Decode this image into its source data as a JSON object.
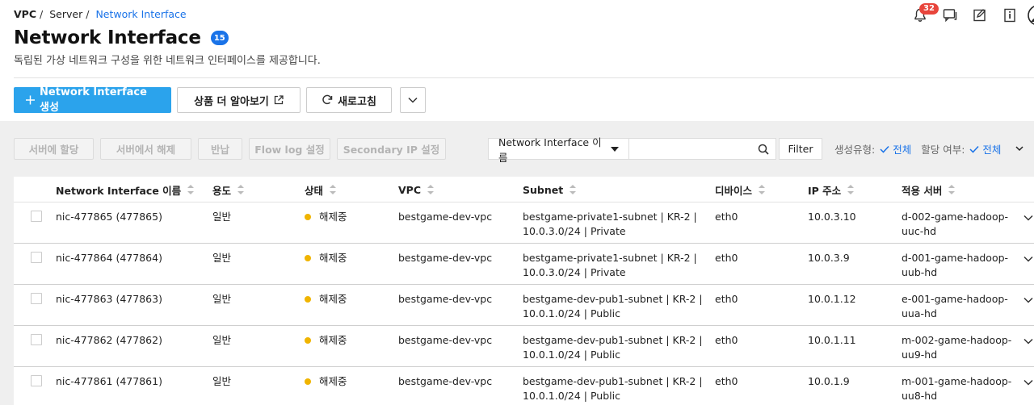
{
  "breadcrumb": {
    "root": "VPC",
    "mid": "Server",
    "current": "Network Interface"
  },
  "header": {
    "notification_count": "32"
  },
  "page": {
    "title": "Network Interface",
    "count": "15",
    "subtitle": "독립된 가상 네트워크 구성을 위한 네트워크 인터페이스를 제공합니다."
  },
  "actions": {
    "create": "Network Interface 생성",
    "learn_more": "상품 더 알아보기",
    "refresh": "새로고침"
  },
  "toolbar": {
    "assign_server": "서버에 할당",
    "release_server": "서버에서 해제",
    "return": "반납",
    "flowlog": "Flow log 설정",
    "secondary_ip": "Secondary IP 설정"
  },
  "search": {
    "field": "Network Interface 이름",
    "value": ""
  },
  "filter": {
    "label": "Filter",
    "type_label": "생성유형:",
    "type_value": "전체",
    "assign_label": "할당 여부:",
    "assign_value": "전체"
  },
  "columns": [
    "Network Interface 이름",
    "용도",
    "상태",
    "VPC",
    "Subnet",
    "디바이스",
    "IP 주소",
    "적용 서버"
  ],
  "rows": [
    {
      "name": "nic-477865 (477865)",
      "usage": "일반",
      "status": "해제중",
      "vpc": "bestgame-dev-vpc",
      "subnet1": "bestgame-private1-subnet | KR-2 |",
      "subnet2": "10.0.3.0/24 | Private",
      "device": "eth0",
      "ip": "10.0.3.10",
      "server1": "d-002-game-hadoop-",
      "server2": "uuc-hd"
    },
    {
      "name": "nic-477864 (477864)",
      "usage": "일반",
      "status": "해제중",
      "vpc": "bestgame-dev-vpc",
      "subnet1": "bestgame-private1-subnet | KR-2 |",
      "subnet2": "10.0.3.0/24 | Private",
      "device": "eth0",
      "ip": "10.0.3.9",
      "server1": "d-001-game-hadoop-",
      "server2": "uub-hd"
    },
    {
      "name": "nic-477863 (477863)",
      "usage": "일반",
      "status": "해제중",
      "vpc": "bestgame-dev-vpc",
      "subnet1": "bestgame-dev-pub1-subnet | KR-2 |",
      "subnet2": "10.0.1.0/24 | Public",
      "device": "eth0",
      "ip": "10.0.1.12",
      "server1": "e-001-game-hadoop-",
      "server2": "uua-hd"
    },
    {
      "name": "nic-477862 (477862)",
      "usage": "일반",
      "status": "해제중",
      "vpc": "bestgame-dev-vpc",
      "subnet1": "bestgame-dev-pub1-subnet | KR-2 |",
      "subnet2": "10.0.1.0/24 | Public",
      "device": "eth0",
      "ip": "10.0.1.11",
      "server1": "m-002-game-hadoop-",
      "server2": "uu9-hd"
    },
    {
      "name": "nic-477861 (477861)",
      "usage": "일반",
      "status": "해제중",
      "vpc": "bestgame-dev-vpc",
      "subnet1": "bestgame-dev-pub1-subnet | KR-2 |",
      "subnet2": "10.0.1.0/24 | Public",
      "device": "eth0",
      "ip": "10.0.1.9",
      "server1": "m-001-game-hadoop-",
      "server2": "uu8-hd"
    }
  ],
  "colors": {
    "primary": "#2ba3ec",
    "link": "#1a73e8",
    "status_dot": "#f0b400",
    "badge_red": "#e8453c"
  },
  "icons": [
    "bell-icon",
    "chat-icon",
    "edit-icon",
    "info-icon",
    "user-icon",
    "plus-icon",
    "external-link-icon",
    "refresh-icon",
    "chevron-down-icon",
    "search-icon",
    "check-icon"
  ]
}
